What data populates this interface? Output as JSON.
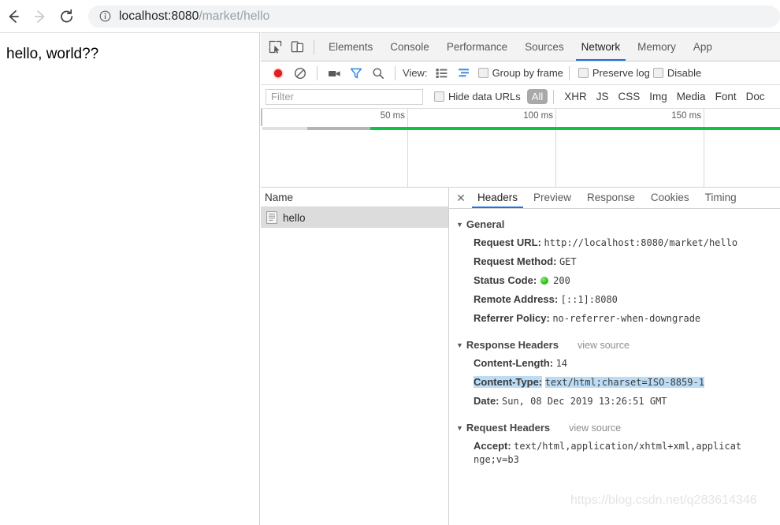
{
  "browser": {
    "nav": {
      "back_icon": "arrow-left-icon",
      "forward_icon": "arrow-right-icon",
      "reload_icon": "reload-icon"
    },
    "omnibox": {
      "info_icon": "info-circle-icon",
      "url_host": "localhost:8080",
      "url_path": "/market/hello",
      "full_url": "localhost:8080/market/hello"
    }
  },
  "page": {
    "body_text": "hello, world??"
  },
  "devtools": {
    "toolbar_icons": {
      "inspect": "inspect-element-icon",
      "device": "device-toolbar-icon"
    },
    "tabs": [
      {
        "label": "Elements",
        "active": false
      },
      {
        "label": "Console",
        "active": false
      },
      {
        "label": "Performance",
        "active": false
      },
      {
        "label": "Sources",
        "active": false
      },
      {
        "label": "Network",
        "active": true
      },
      {
        "label": "Memory",
        "active": false
      },
      {
        "label": "App",
        "active": false
      }
    ],
    "controls": {
      "record_icon": "record-button-icon",
      "clear_icon": "clear-icon",
      "capture_screenshots_icon": "camera-icon",
      "filter_icon": "filter-funnel-icon",
      "search_icon": "search-icon",
      "view_label": "View:",
      "view_list_icon": "list-view-icon",
      "view_waterfall_icon": "waterfall-view-icon",
      "group_by_frame": "Group by frame",
      "preserve_log": "Preserve log",
      "disable_cache": "Disable"
    },
    "filterbar": {
      "filter_placeholder": "Filter",
      "filter_value": "",
      "hide_data_urls": "Hide data URLs",
      "types": [
        "All",
        "XHR",
        "JS",
        "CSS",
        "Img",
        "Media",
        "Font",
        "Doc"
      ],
      "active_type": "All"
    },
    "overview": {
      "ticks": [
        "50 ms",
        "100 ms",
        "150 ms"
      ],
      "bar_color": "#0ec445"
    },
    "requests": {
      "column_header": "Name",
      "rows": [
        {
          "name": "hello",
          "icon": "document-icon",
          "selected": true
        }
      ]
    },
    "detail": {
      "close_icon": "close-icon",
      "tabs": [
        {
          "label": "Headers",
          "active": true
        },
        {
          "label": "Preview",
          "active": false
        },
        {
          "label": "Response",
          "active": false
        },
        {
          "label": "Cookies",
          "active": false
        },
        {
          "label": "Timing",
          "active": false
        }
      ],
      "view_source": "view source",
      "sections": [
        {
          "title": "General",
          "has_view_source": false,
          "rows": [
            {
              "name": "Request URL:",
              "value": "http://localhost:8080/market/hello"
            },
            {
              "name": "Request Method:",
              "value": "GET"
            },
            {
              "name": "Status Code:",
              "value": "200",
              "status_dot": true
            },
            {
              "name": "Remote Address:",
              "value": "[::1]:8080"
            },
            {
              "name": "Referrer Policy:",
              "value": "no-referrer-when-downgrade"
            }
          ]
        },
        {
          "title": "Response Headers",
          "has_view_source": true,
          "rows": [
            {
              "name": "Content-Length:",
              "value": "14"
            },
            {
              "name": "Content-Type:",
              "value": "text/html;charset=ISO-8859-1",
              "highlighted": true
            },
            {
              "name": "Date:",
              "value": "Sun, 08 Dec 2019 13:26:51 GMT"
            }
          ]
        },
        {
          "title": "Request Headers",
          "has_view_source": true,
          "rows": [
            {
              "name": "Accept:",
              "value": "text/html,application/xhtml+xml,applicat nge;v=b3"
            }
          ]
        }
      ]
    }
  },
  "watermark": "https://blog.csdn.net/q283614346"
}
